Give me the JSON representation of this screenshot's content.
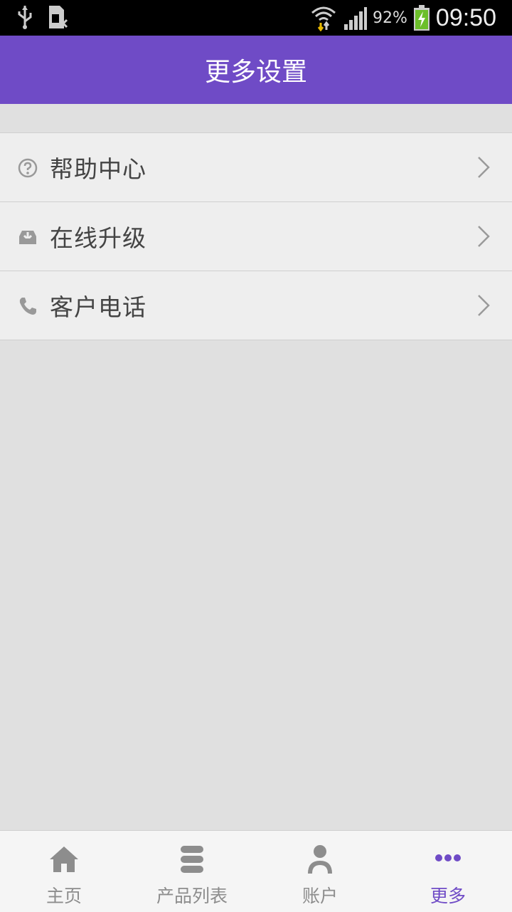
{
  "status_bar": {
    "battery_percent": "92%",
    "time": "09:50"
  },
  "header": {
    "title": "更多设置"
  },
  "menu": {
    "items": [
      {
        "label": "帮助中心",
        "icon": "help-circle-icon"
      },
      {
        "label": "在线升级",
        "icon": "download-tray-icon"
      },
      {
        "label": "客户电话",
        "icon": "phone-icon"
      }
    ]
  },
  "tab_bar": {
    "tabs": [
      {
        "label": "主页",
        "icon": "home-icon"
      },
      {
        "label": "产品列表",
        "icon": "list-icon"
      },
      {
        "label": "账户",
        "icon": "user-icon"
      },
      {
        "label": "更多",
        "icon": "more-icon",
        "active": true
      }
    ],
    "accent_color": "#6f4bc6",
    "inactive_color": "#8d8d8d"
  }
}
